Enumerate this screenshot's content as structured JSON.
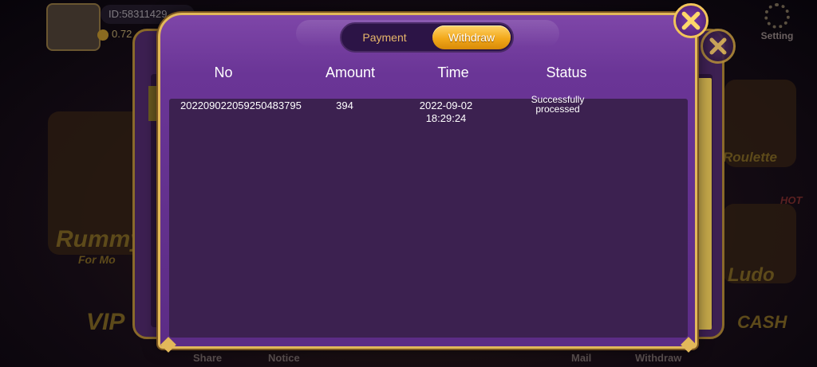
{
  "background": {
    "user_id": "ID:58311429",
    "balance": "0.72",
    "setting_label": "Setting",
    "game_labels": [
      "Rummy",
      "For Mo",
      "Roulette",
      "HOT",
      "Ludo",
      "VIP",
      "CASH"
    ],
    "bottom_nav": [
      "Share",
      "Notice",
      "Mail",
      "Withdraw"
    ]
  },
  "dialog": {
    "tabs": [
      {
        "label": "Payment",
        "active": false
      },
      {
        "label": "Withdraw",
        "active": true
      }
    ],
    "columns": [
      "No",
      "Amount",
      "Time",
      "Status"
    ],
    "rows": [
      {
        "no": "20220902205925048​3795",
        "amount": "394",
        "time": "2022-09-02 18:29:24",
        "status": "Successfully processed"
      }
    ]
  },
  "icons": {
    "close_main": "close-icon",
    "close_back": "close-icon"
  },
  "colors": {
    "frame_gold": "#e2b85a",
    "dialog_purple": "#6a3596",
    "table_bg": "#3c2150",
    "active_tab": "#f2a81a"
  }
}
